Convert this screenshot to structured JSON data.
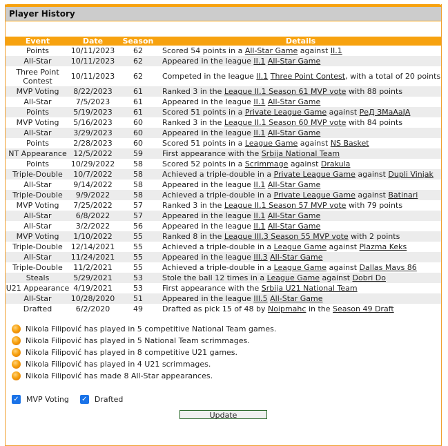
{
  "panel": {
    "title": "Player History"
  },
  "table": {
    "headers": [
      "Event",
      "Date",
      "Season",
      "Details"
    ],
    "rows": [
      {
        "event": "Points",
        "date": "10/11/2023",
        "season": "62",
        "details": [
          [
            "t",
            "Scored 54 points in a "
          ],
          [
            "l",
            "All-Star Game"
          ],
          [
            "t",
            " against "
          ],
          [
            "l",
            "II.1"
          ]
        ]
      },
      {
        "event": "All-Star",
        "date": "10/11/2023",
        "season": "62",
        "details": [
          [
            "t",
            "Appeared in the league "
          ],
          [
            "l",
            "II.1"
          ],
          [
            "t",
            " "
          ],
          [
            "l",
            "All-Star Game"
          ]
        ]
      },
      {
        "event": "Three Point Contest",
        "date": "10/11/2023",
        "season": "62",
        "tall": true,
        "details": [
          [
            "t",
            "Competed in the league "
          ],
          [
            "l",
            "II.1"
          ],
          [
            "t",
            " "
          ],
          [
            "l",
            "Three Point Contest"
          ],
          [
            "t",
            ", with a total of 20 points"
          ]
        ]
      },
      {
        "event": "MVP Voting",
        "date": "8/22/2023",
        "season": "61",
        "details": [
          [
            "t",
            "Ranked 3 in the "
          ],
          [
            "l",
            "League II.1 Season 61 MVP vote"
          ],
          [
            "t",
            " with 88 points"
          ]
        ]
      },
      {
        "event": "All-Star",
        "date": "7/5/2023",
        "season": "61",
        "details": [
          [
            "t",
            "Appeared in the league "
          ],
          [
            "l",
            "II.1"
          ],
          [
            "t",
            " "
          ],
          [
            "l",
            "All-Star Game"
          ]
        ]
      },
      {
        "event": "Points",
        "date": "5/19/2023",
        "season": "61",
        "details": [
          [
            "t",
            "Scored 51 points in a "
          ],
          [
            "l",
            "Private League Game"
          ],
          [
            "t",
            " against "
          ],
          [
            "l",
            "РеД ЗМаАаЈА"
          ]
        ]
      },
      {
        "event": "MVP Voting",
        "date": "5/16/2023",
        "season": "60",
        "details": [
          [
            "t",
            "Ranked 3 in the "
          ],
          [
            "l",
            "League II.1 Season 60 MVP vote"
          ],
          [
            "t",
            " with 84 points"
          ]
        ]
      },
      {
        "event": "All-Star",
        "date": "3/29/2023",
        "season": "60",
        "details": [
          [
            "t",
            "Appeared in the league "
          ],
          [
            "l",
            "II.1"
          ],
          [
            "t",
            " "
          ],
          [
            "l",
            "All-Star Game"
          ]
        ]
      },
      {
        "event": "Points",
        "date": "2/28/2023",
        "season": "60",
        "details": [
          [
            "t",
            "Scored 51 points in a "
          ],
          [
            "l",
            "League Game"
          ],
          [
            "t",
            " against "
          ],
          [
            "l",
            "NS Basket"
          ]
        ]
      },
      {
        "event": "NT Appearance",
        "date": "12/5/2022",
        "season": "59",
        "details": [
          [
            "t",
            "First appearance with the "
          ],
          [
            "l",
            "Srbija National Team"
          ]
        ]
      },
      {
        "event": "Points",
        "date": "10/29/2022",
        "season": "58",
        "details": [
          [
            "t",
            "Scored 52 points in a "
          ],
          [
            "l",
            "Scrimmage"
          ],
          [
            "t",
            " against "
          ],
          [
            "l",
            "Drakula"
          ]
        ]
      },
      {
        "event": "Triple-Double",
        "date": "10/7/2022",
        "season": "58",
        "details": [
          [
            "t",
            "Achieved a triple-double in a "
          ],
          [
            "l",
            "Private League Game"
          ],
          [
            "t",
            " against "
          ],
          [
            "l",
            "Dupli Vinjak"
          ]
        ]
      },
      {
        "event": "All-Star",
        "date": "9/14/2022",
        "season": "58",
        "details": [
          [
            "t",
            "Appeared in the league "
          ],
          [
            "l",
            "II.1"
          ],
          [
            "t",
            " "
          ],
          [
            "l",
            "All-Star Game"
          ]
        ]
      },
      {
        "event": "Triple-Double",
        "date": "9/9/2022",
        "season": "58",
        "details": [
          [
            "t",
            "Achieved a triple-double in a "
          ],
          [
            "l",
            "Private League Game"
          ],
          [
            "t",
            " against "
          ],
          [
            "l",
            "Batinari"
          ]
        ]
      },
      {
        "event": "MVP Voting",
        "date": "7/25/2022",
        "season": "57",
        "details": [
          [
            "t",
            "Ranked 3 in the "
          ],
          [
            "l",
            "League II.1 Season 57 MVP vote"
          ],
          [
            "t",
            " with 79 points"
          ]
        ]
      },
      {
        "event": "All-Star",
        "date": "6/8/2022",
        "season": "57",
        "details": [
          [
            "t",
            "Appeared in the league "
          ],
          [
            "l",
            "II.1"
          ],
          [
            "t",
            " "
          ],
          [
            "l",
            "All-Star Game"
          ]
        ]
      },
      {
        "event": "All-Star",
        "date": "3/2/2022",
        "season": "56",
        "details": [
          [
            "t",
            "Appeared in the league "
          ],
          [
            "l",
            "II.1"
          ],
          [
            "t",
            " "
          ],
          [
            "l",
            "All-Star Game"
          ]
        ]
      },
      {
        "event": "MVP Voting",
        "date": "1/10/2022",
        "season": "55",
        "details": [
          [
            "t",
            "Ranked 8 in the "
          ],
          [
            "l",
            "League III.3 Season 55 MVP vote"
          ],
          [
            "t",
            " with 2 points"
          ]
        ]
      },
      {
        "event": "Triple-Double",
        "date": "12/14/2021",
        "season": "55",
        "details": [
          [
            "t",
            "Achieved a triple-double in a "
          ],
          [
            "l",
            "League Game"
          ],
          [
            "t",
            " against "
          ],
          [
            "l",
            "Plazma Keks"
          ]
        ]
      },
      {
        "event": "All-Star",
        "date": "11/24/2021",
        "season": "55",
        "details": [
          [
            "t",
            "Appeared in the league "
          ],
          [
            "l",
            "III.3"
          ],
          [
            "t",
            " "
          ],
          [
            "l",
            "All-Star Game"
          ]
        ]
      },
      {
        "event": "Triple-Double",
        "date": "11/2/2021",
        "season": "55",
        "details": [
          [
            "t",
            "Achieved a triple-double in a "
          ],
          [
            "l",
            "League Game"
          ],
          [
            "t",
            " against "
          ],
          [
            "l",
            "Dallas Mavs 86"
          ]
        ]
      },
      {
        "event": "Steals",
        "date": "5/29/2021",
        "season": "53",
        "details": [
          [
            "t",
            "Stole the ball 12 times in a "
          ],
          [
            "l",
            "League Game"
          ],
          [
            "t",
            " against "
          ],
          [
            "l",
            "Dobri Do"
          ]
        ]
      },
      {
        "event": "U21 Appearance",
        "date": "4/19/2021",
        "season": "53",
        "details": [
          [
            "t",
            "First appearance with the "
          ],
          [
            "l",
            "Srbija U21 National Team"
          ]
        ]
      },
      {
        "event": "All-Star",
        "date": "10/28/2020",
        "season": "51",
        "details": [
          [
            "t",
            "Appeared in the league "
          ],
          [
            "l",
            "III.5"
          ],
          [
            "t",
            " "
          ],
          [
            "l",
            "All-Star Game"
          ]
        ]
      },
      {
        "event": "Drafted",
        "date": "6/2/2020",
        "season": "49",
        "details": [
          [
            "t",
            "Drafted as pick 15 of 48 by "
          ],
          [
            "l",
            "Noipmahc"
          ],
          [
            "t",
            " in the "
          ],
          [
            "l",
            "Season 49 Draft"
          ]
        ]
      }
    ]
  },
  "facts": [
    "Nikola Filipović has played in 5 competitive National Team games.",
    "Nikola Filipović has played in 5 National Team scrimmages.",
    "Nikola Filipović has played in 8 competitive U21 games.",
    "Nikola Filipović has played in 4 U21 scrimmages.",
    "Nikola Filipović has made 8 All-Star appearances."
  ],
  "filters": [
    {
      "label": "MVP Voting",
      "checked": true
    },
    {
      "label": "Drafted",
      "checked": true
    }
  ],
  "update_button": "Update",
  "colors": {
    "accent": "#f7a20f",
    "header_gray": "#cccccc",
    "row_alt": "#ececec",
    "button_border": "#2d6a2d"
  }
}
